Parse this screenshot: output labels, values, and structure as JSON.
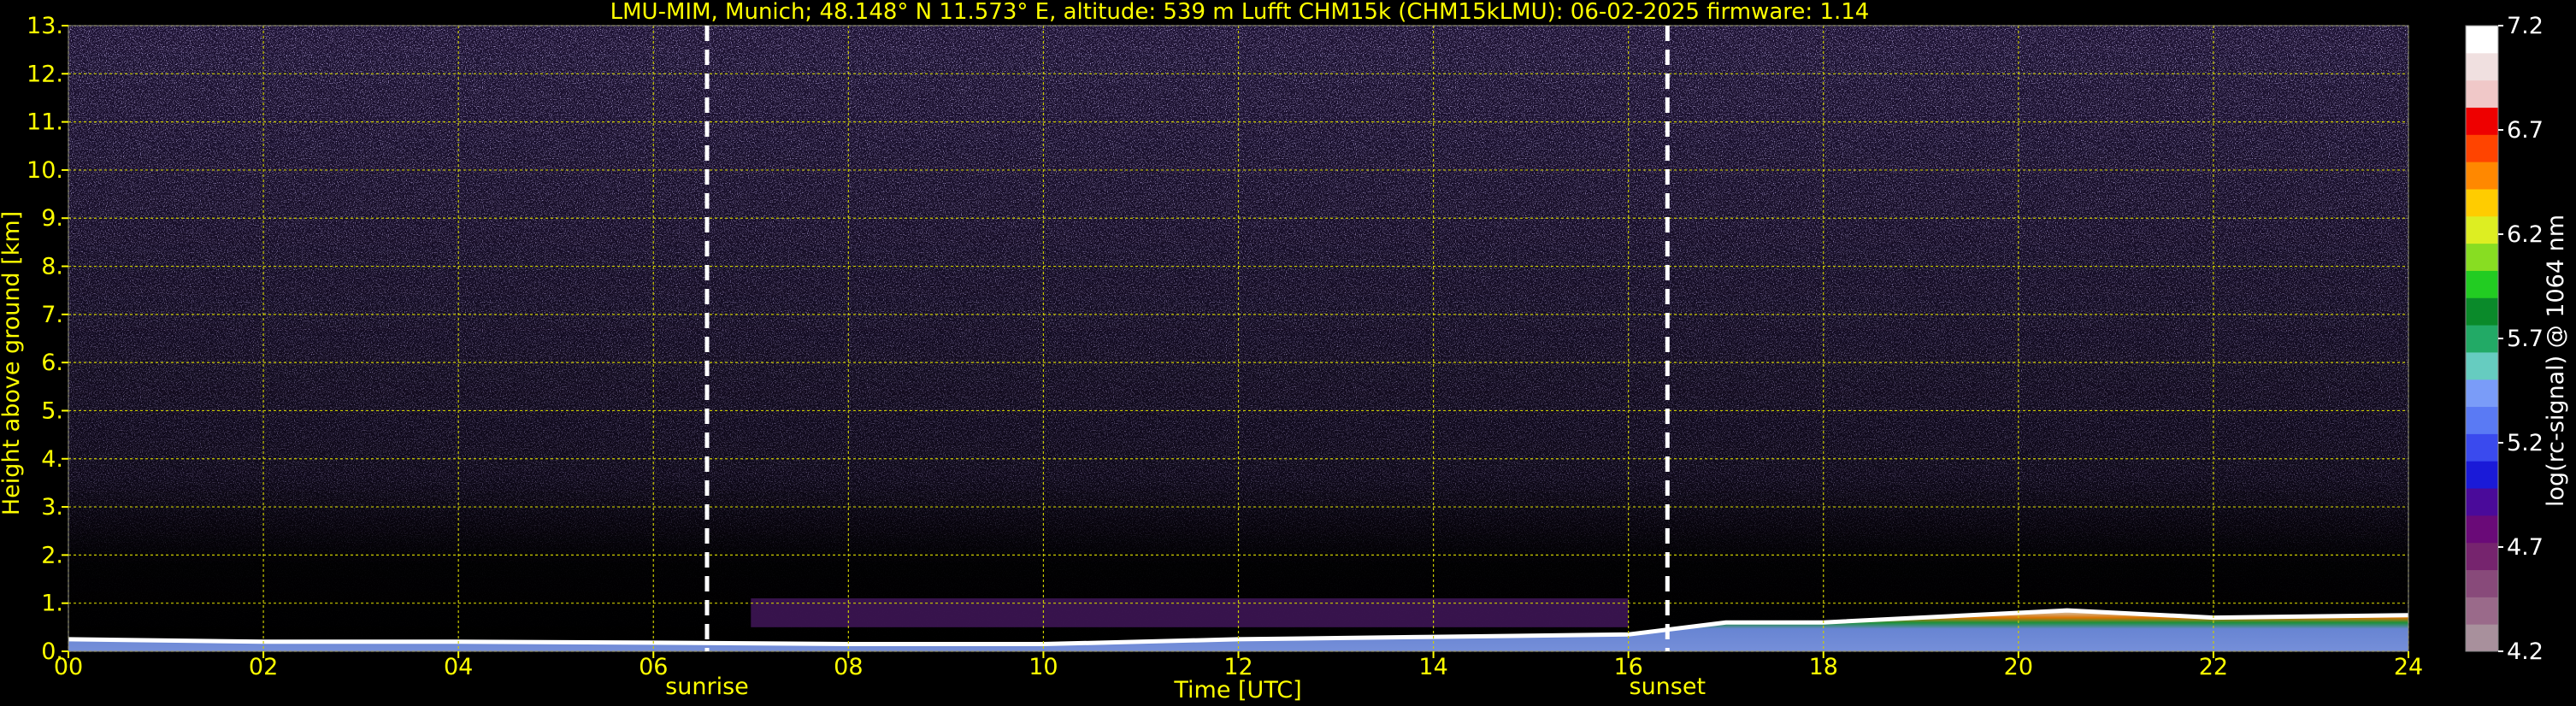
{
  "chart_data": {
    "type": "heatmap",
    "title": "LMU-MIM, Munich; 48.148° N 11.573° E, altitude: 539 m    Lufft CHM15k (CHM15kLMU): 06-02-2025    firmware: 1.14",
    "xlabel": "Time [UTC]",
    "ylabel": "Height above ground [km]",
    "colorbar_label": "log(rc-signal) @ 1064 nm",
    "xlim": [
      0,
      24
    ],
    "ylim": [
      0,
      13
    ],
    "x_ticks": [
      "00",
      "02",
      "04",
      "06",
      "08",
      "10",
      "12",
      "14",
      "16",
      "18",
      "20",
      "22",
      "24"
    ],
    "y_ticks": [
      "0.",
      "1.",
      "2.",
      "3.",
      "4.",
      "5.",
      "6.",
      "7.",
      "8.",
      "9.",
      "10.",
      "11.",
      "12.",
      "13."
    ],
    "colorbar_range": [
      4.2,
      7.2
    ],
    "colorbar_ticks": [
      "4.2",
      "4.7",
      "5.2",
      "5.7",
      "6.2",
      "6.7",
      "7.2"
    ],
    "grid": true,
    "events": [
      {
        "label": "sunrise",
        "time": 6.55
      },
      {
        "label": "sunset",
        "time": 16.4
      }
    ],
    "boundary_layer": {
      "time": [
        0,
        2,
        4,
        6,
        8,
        10,
        12,
        14,
        16,
        17,
        18,
        20,
        20.5,
        22,
        24
      ],
      "height_km": [
        0.25,
        0.2,
        0.2,
        0.18,
        0.15,
        0.15,
        0.25,
        0.3,
        0.35,
        0.6,
        0.6,
        0.8,
        0.85,
        0.7,
        0.75
      ]
    },
    "elevated_layer": {
      "t_start": 7,
      "t_end": 16,
      "height_km": [
        0.5,
        1.1
      ]
    }
  },
  "colors": {
    "background": "#000000",
    "text": "#ffff00",
    "grid": "#cccc00",
    "colorbar": [
      "#a8909c",
      "#9a6a8a",
      "#884a7a",
      "#76246e",
      "#6a0a78",
      "#4a0a9a",
      "#1a1ad8",
      "#3a4aee",
      "#5a7af4",
      "#7a9cf8",
      "#66ccc0",
      "#22aa66",
      "#0a8a2a",
      "#22cc22",
      "#88dd22",
      "#ddee22",
      "#ffcc00",
      "#ff8800",
      "#ff4400",
      "#ee0000",
      "#f0c8c8",
      "#f0e0e0",
      "#ffffff"
    ]
  }
}
